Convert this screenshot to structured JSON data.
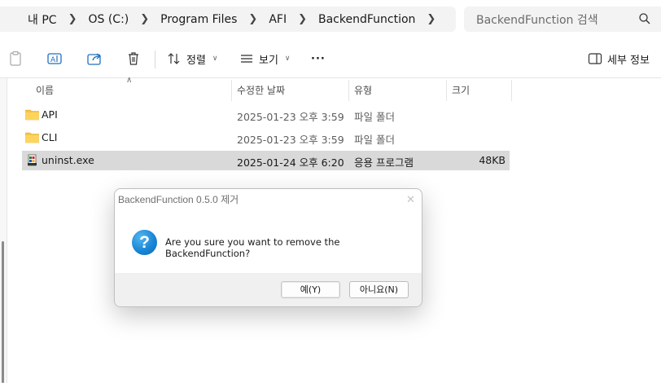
{
  "addressbar": {
    "crumbs": [
      "내 PC",
      "OS (C:)",
      "Program Files",
      "AFI",
      "BackendFunction"
    ],
    "search_placeholder": "BackendFunction 검색"
  },
  "commandbar": {
    "sort_label": "정렬",
    "view_label": "보기",
    "more_label": "···",
    "details_label": "세부 정보"
  },
  "columns": {
    "name": "이름",
    "modified": "수정한 날짜",
    "type": "유형",
    "size": "크기"
  },
  "files": [
    {
      "name": "API",
      "modified": "2025-01-23 오후 3:59",
      "type": "파일 폴더",
      "size": "",
      "icon": "folder-icon",
      "selected": false
    },
    {
      "name": "CLI",
      "modified": "2025-01-23 오후 3:59",
      "type": "파일 폴더",
      "size": "",
      "icon": "folder-icon",
      "selected": false
    },
    {
      "name": "uninst.exe",
      "modified": "2025-01-24 오후 6:20",
      "type": "응용 프로그램",
      "size": "48KB",
      "icon": "installer-icon",
      "selected": true
    }
  ],
  "dialog": {
    "title": "BackendFunction 0.5.0 제거",
    "message": "Are you sure you want to remove the BackendFunction?",
    "yes_label": "예(Y)",
    "no_label": "아니요(N)",
    "icon": "question-icon"
  },
  "colors": {
    "selection": "#d9d9d9",
    "folder": "#f6c346",
    "question_blue": "#1a86d6",
    "dialog_footer": "#f0f0f0"
  }
}
